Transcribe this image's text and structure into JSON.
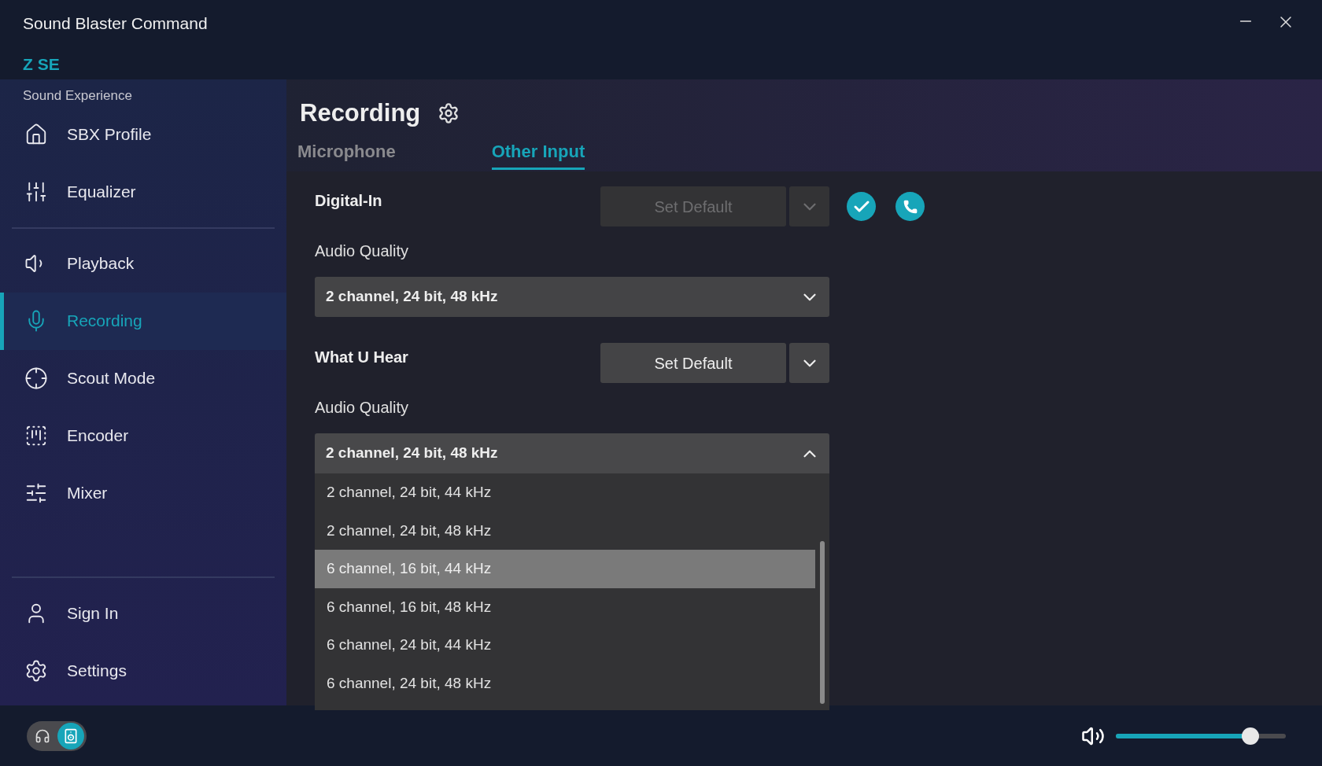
{
  "app": {
    "title": "Sound Blaster Command",
    "device": "Z SE"
  },
  "sidebar": {
    "section_label": "Sound Experience",
    "groups": [
      {
        "items": [
          {
            "label": "SBX Profile",
            "selected": false
          },
          {
            "label": "Equalizer",
            "selected": false
          }
        ]
      },
      {
        "items": [
          {
            "label": "Playback",
            "selected": false
          },
          {
            "label": "Recording",
            "selected": true
          },
          {
            "label": "Scout Mode",
            "selected": false
          },
          {
            "label": "Encoder",
            "selected": false
          },
          {
            "label": "Mixer",
            "selected": false
          }
        ]
      },
      {
        "items": [
          {
            "label": "Sign In",
            "selected": false
          },
          {
            "label": "Settings",
            "selected": false
          }
        ]
      }
    ]
  },
  "page": {
    "title": "Recording"
  },
  "tabs": [
    {
      "label": "Microphone",
      "selected": false
    },
    {
      "label": "Other Input",
      "selected": true
    }
  ],
  "devices": [
    {
      "name": "Digital-In",
      "set_default": {
        "label": "Set Default",
        "disabled": true
      },
      "is_default": true,
      "is_default_communication": true,
      "quality_label": "Audio Quality",
      "quality": {
        "value": "2 channel, 24 bit, 48 kHz",
        "expanded": false
      }
    },
    {
      "name": "What U Hear",
      "set_default": {
        "label": "Set Default",
        "disabled": false
      },
      "is_default": false,
      "is_default_communication": false,
      "quality_label": "Audio Quality",
      "quality": {
        "value": "2 channel, 24 bit, 48 kHz",
        "expanded": true,
        "options": [
          {
            "label": "2 channel, 24 bit, 44 kHz",
            "highlighted": false
          },
          {
            "label": "2 channel, 24 bit, 48 kHz",
            "highlighted": false
          },
          {
            "label": "6 channel, 16 bit, 44 kHz",
            "highlighted": true
          },
          {
            "label": "6 channel, 16 bit, 48 kHz",
            "highlighted": false
          },
          {
            "label": "6 channel, 24 bit, 44 kHz",
            "highlighted": false
          },
          {
            "label": "6 channel, 24 bit, 48 kHz",
            "highlighted": false
          }
        ]
      }
    }
  ],
  "footer": {
    "output_modes": [
      {
        "selected": false
      },
      {
        "selected": true
      }
    ],
    "volume": {
      "level": 0.79
    }
  }
}
